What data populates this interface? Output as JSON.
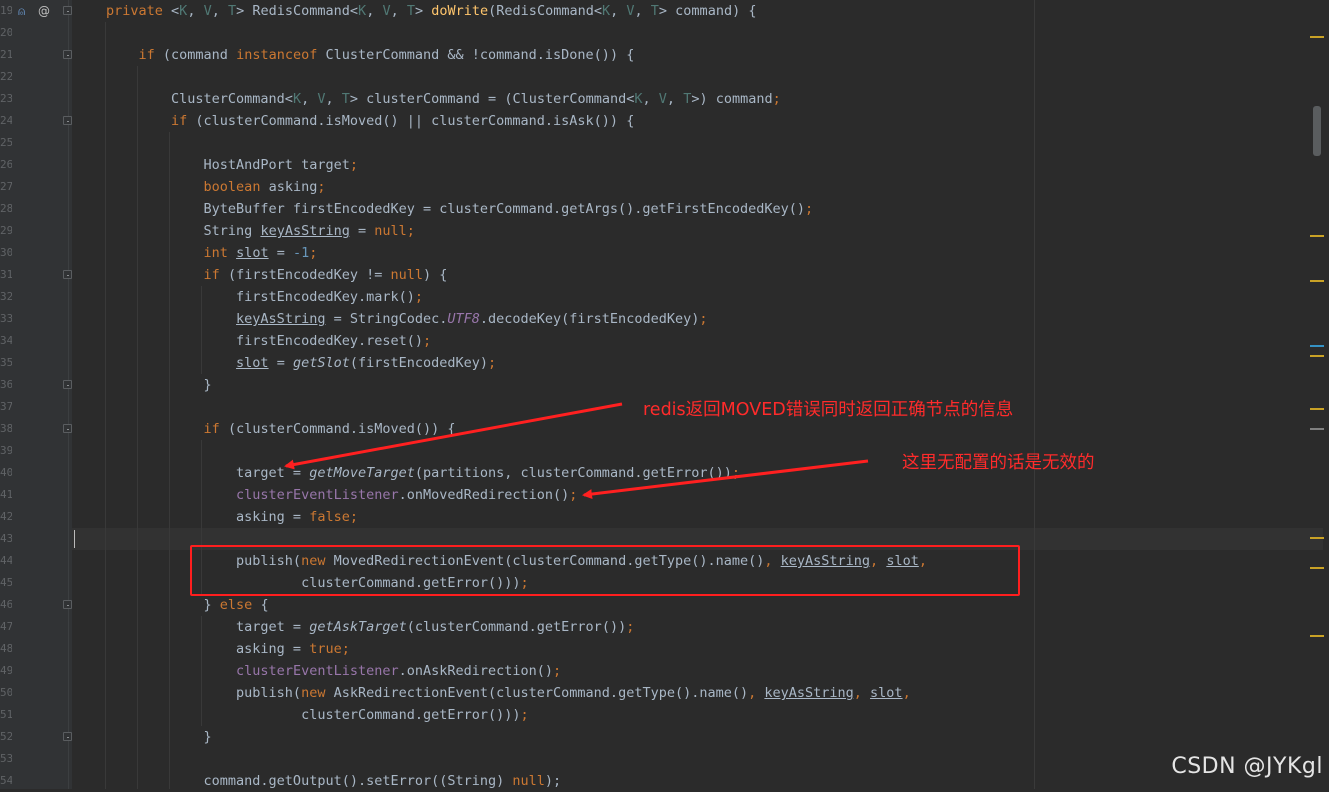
{
  "editor": {
    "lines": [
      {
        "n": "19",
        "segs": [
          {
            "t": "private ",
            "c": "kw"
          },
          {
            "t": "<"
          },
          {
            "t": "K",
            "c": "tp"
          },
          {
            "t": ", "
          },
          {
            "t": "V",
            "c": "tp"
          },
          {
            "t": ", "
          },
          {
            "t": "T",
            "c": "tp"
          },
          {
            "t": "> RedisCommand<"
          },
          {
            "t": "K",
            "c": "tp"
          },
          {
            "t": ", "
          },
          {
            "t": "V",
            "c": "tp"
          },
          {
            "t": ", "
          },
          {
            "t": "T",
            "c": "tp"
          },
          {
            "t": "> "
          },
          {
            "t": "doWrite",
            "c": "fn"
          },
          {
            "t": "(RedisCommand<"
          },
          {
            "t": "K",
            "c": "tp"
          },
          {
            "t": ", "
          },
          {
            "t": "V",
            "c": "tp"
          },
          {
            "t": ", "
          },
          {
            "t": "T",
            "c": "tp"
          },
          {
            "t": "> command) {"
          }
        ]
      },
      {
        "n": "20",
        "segs": []
      },
      {
        "n": "21",
        "segs": [
          {
            "t": "    "
          },
          {
            "t": "if ",
            "c": "kw"
          },
          {
            "t": "(command "
          },
          {
            "t": "instanceof ",
            "c": "kw"
          },
          {
            "t": "ClusterCommand && !command.isDone()) {"
          }
        ]
      },
      {
        "n": "22",
        "segs": []
      },
      {
        "n": "23",
        "segs": [
          {
            "t": "        ClusterCommand<"
          },
          {
            "t": "K",
            "c": "tp"
          },
          {
            "t": ", "
          },
          {
            "t": "V",
            "c": "tp"
          },
          {
            "t": ", "
          },
          {
            "t": "T",
            "c": "tp"
          },
          {
            "t": "> clusterCommand = (ClusterCommand<"
          },
          {
            "t": "K",
            "c": "tp"
          },
          {
            "t": ", "
          },
          {
            "t": "V",
            "c": "tp"
          },
          {
            "t": ", "
          },
          {
            "t": "T",
            "c": "tp"
          },
          {
            "t": ">) command"
          },
          {
            "t": ";",
            "c": "kw"
          }
        ]
      },
      {
        "n": "24",
        "segs": [
          {
            "t": "        "
          },
          {
            "t": "if ",
            "c": "kw"
          },
          {
            "t": "(clusterCommand.isMoved() || clusterCommand.isAsk()) {"
          }
        ]
      },
      {
        "n": "25",
        "segs": []
      },
      {
        "n": "26",
        "segs": [
          {
            "t": "            HostAndPort target"
          },
          {
            "t": ";",
            "c": "kw"
          }
        ]
      },
      {
        "n": "27",
        "segs": [
          {
            "t": "            "
          },
          {
            "t": "boolean ",
            "c": "kw"
          },
          {
            "t": "asking"
          },
          {
            "t": ";",
            "c": "kw"
          }
        ]
      },
      {
        "n": "28",
        "segs": [
          {
            "t": "            ByteBuffer firstEncodedKey = clusterCommand.getArgs().getFirstEncodedKey()"
          },
          {
            "t": ";",
            "c": "kw"
          }
        ]
      },
      {
        "n": "29",
        "segs": [
          {
            "t": "            String "
          },
          {
            "t": "keyAsString",
            "c": "u"
          },
          {
            "t": " = "
          },
          {
            "t": "null",
            "c": "kw"
          },
          {
            "t": ";",
            "c": "kw"
          }
        ]
      },
      {
        "n": "30",
        "segs": [
          {
            "t": "            "
          },
          {
            "t": "int ",
            "c": "kw"
          },
          {
            "t": "slot",
            "c": "u"
          },
          {
            "t": " = "
          },
          {
            "t": "-1",
            "c": "num"
          },
          {
            "t": ";",
            "c": "kw"
          }
        ]
      },
      {
        "n": "31",
        "segs": [
          {
            "t": "            "
          },
          {
            "t": "if ",
            "c": "kw"
          },
          {
            "t": "(firstEncodedKey != "
          },
          {
            "t": "null",
            "c": "kw"
          },
          {
            "t": ") {"
          }
        ]
      },
      {
        "n": "32",
        "segs": [
          {
            "t": "                firstEncodedKey.mark()"
          },
          {
            "t": ";",
            "c": "kw"
          }
        ]
      },
      {
        "n": "33",
        "segs": [
          {
            "t": "                "
          },
          {
            "t": "keyAsString",
            "c": "u"
          },
          {
            "t": " = StringCodec."
          },
          {
            "t": "UTF8",
            "c": "stf"
          },
          {
            "t": ".decodeKey(firstEncodedKey)"
          },
          {
            "t": ";",
            "c": "kw"
          }
        ]
      },
      {
        "n": "34",
        "segs": [
          {
            "t": "                firstEncodedKey.reset()"
          },
          {
            "t": ";",
            "c": "kw"
          }
        ]
      },
      {
        "n": "35",
        "segs": [
          {
            "t": "                "
          },
          {
            "t": "slot",
            "c": "u"
          },
          {
            "t": " = "
          },
          {
            "t": "getSlot",
            "c": "st"
          },
          {
            "t": "(firstEncodedKey)"
          },
          {
            "t": ";",
            "c": "kw"
          }
        ]
      },
      {
        "n": "36",
        "segs": [
          {
            "t": "            }"
          }
        ]
      },
      {
        "n": "37",
        "segs": []
      },
      {
        "n": "38",
        "segs": [
          {
            "t": "            "
          },
          {
            "t": "if ",
            "c": "kw"
          },
          {
            "t": "(clusterCommand.isMoved()) {"
          }
        ]
      },
      {
        "n": "39",
        "segs": []
      },
      {
        "n": "40",
        "segs": [
          {
            "t": "                target = "
          },
          {
            "t": "getMoveTarget",
            "c": "st"
          },
          {
            "t": "(partitions, clusterCommand.getError())"
          },
          {
            "t": ";",
            "c": "kw"
          }
        ]
      },
      {
        "n": "41",
        "segs": [
          {
            "t": "                "
          },
          {
            "t": "clusterEventListener",
            "c": "fld"
          },
          {
            "t": ".onMovedRedirection()"
          },
          {
            "t": ";",
            "c": "kw"
          }
        ]
      },
      {
        "n": "42",
        "segs": [
          {
            "t": "                asking = "
          },
          {
            "t": "false",
            "c": "kw"
          },
          {
            "t": ";",
            "c": "kw"
          }
        ]
      },
      {
        "n": "43",
        "segs": []
      },
      {
        "n": "44",
        "segs": [
          {
            "t": "                publish("
          },
          {
            "t": "new ",
            "c": "kw"
          },
          {
            "t": "MovedRedirectionEvent(clusterCommand.getType().name()"
          },
          {
            "t": ", ",
            "c": "kw"
          },
          {
            "t": "keyAsString",
            "c": "u"
          },
          {
            "t": ", ",
            "c": "kw"
          },
          {
            "t": "slot",
            "c": "u"
          },
          {
            "t": ",",
            "c": "kw"
          }
        ]
      },
      {
        "n": "45",
        "segs": [
          {
            "t": "                        clusterCommand.getError()))"
          },
          {
            "t": ";",
            "c": "kw"
          }
        ]
      },
      {
        "n": "46",
        "segs": [
          {
            "t": "            } "
          },
          {
            "t": "else ",
            "c": "kw"
          },
          {
            "t": "{"
          }
        ]
      },
      {
        "n": "47",
        "segs": [
          {
            "t": "                target = "
          },
          {
            "t": "getAskTarget",
            "c": "st"
          },
          {
            "t": "(clusterCommand.getError())"
          },
          {
            "t": ";",
            "c": "kw"
          }
        ]
      },
      {
        "n": "48",
        "segs": [
          {
            "t": "                asking = "
          },
          {
            "t": "true",
            "c": "kw"
          },
          {
            "t": ";",
            "c": "kw"
          }
        ]
      },
      {
        "n": "49",
        "segs": [
          {
            "t": "                "
          },
          {
            "t": "clusterEventListener",
            "c": "fld"
          },
          {
            "t": ".onAskRedirection()"
          },
          {
            "t": ";",
            "c": "kw"
          }
        ]
      },
      {
        "n": "50",
        "segs": [
          {
            "t": "                publish("
          },
          {
            "t": "new ",
            "c": "kw"
          },
          {
            "t": "AskRedirectionEvent(clusterCommand.getType().name()"
          },
          {
            "t": ", ",
            "c": "kw"
          },
          {
            "t": "keyAsString",
            "c": "u"
          },
          {
            "t": ", ",
            "c": "kw"
          },
          {
            "t": "slot",
            "c": "u"
          },
          {
            "t": ",",
            "c": "kw"
          }
        ]
      },
      {
        "n": "51",
        "segs": [
          {
            "t": "                        clusterCommand.getError()))"
          },
          {
            "t": ";",
            "c": "kw"
          }
        ]
      },
      {
        "n": "52",
        "segs": [
          {
            "t": "            }"
          }
        ]
      },
      {
        "n": "53",
        "segs": []
      },
      {
        "n": "54",
        "segs": [
          {
            "t": "            command.getOutput().setError((String) "
          },
          {
            "t": "null",
            "c": "kw"
          },
          {
            "t": ");"
          }
        ]
      }
    ]
  },
  "annotations": {
    "moved_note": "redis返回MOVED错误同时返回正确节点的信息",
    "listener_note": "这里无配置的话是无效的"
  },
  "watermark": "CSDN @JYKgl",
  "colors": {
    "background": "#2b2b2b",
    "keyword": "#cc7832",
    "method": "#ffc66d",
    "field": "#9876aa",
    "annotation_red": "#ff2b2b"
  }
}
